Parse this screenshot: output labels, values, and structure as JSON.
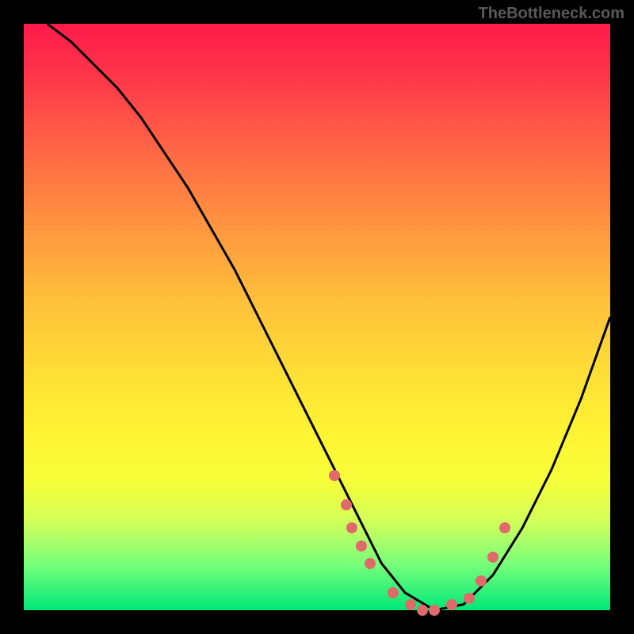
{
  "watermark": "TheBottleneck.com",
  "chart_data": {
    "type": "line",
    "title": "",
    "xlabel": "",
    "ylabel": "",
    "xlim": [
      0,
      100
    ],
    "ylim": [
      0,
      100
    ],
    "series": [
      {
        "name": "curve",
        "style": "line",
        "x": [
          4,
          8,
          12,
          16,
          20,
          24,
          28,
          32,
          36,
          40,
          44,
          48,
          52,
          55,
          58,
          61,
          65,
          70,
          75,
          80,
          85,
          90,
          95,
          100
        ],
        "y": [
          100,
          97,
          93,
          89,
          84,
          78,
          72,
          65,
          58,
          50,
          42,
          34,
          26,
          20,
          14,
          8,
          3,
          0,
          1,
          6,
          14,
          24,
          36,
          50
        ]
      },
      {
        "name": "points",
        "style": "scatter",
        "x": [
          53,
          55,
          56,
          57.5,
          59,
          63,
          66,
          68,
          70,
          73,
          76,
          78,
          80,
          82
        ],
        "y": [
          23,
          18,
          14,
          11,
          8,
          3,
          1,
          0,
          0,
          1,
          2,
          5,
          9,
          14
        ]
      }
    ],
    "background_gradient": {
      "top": "#ff1a4a",
      "mid": "#fff433",
      "bottom": "#00e878"
    }
  }
}
